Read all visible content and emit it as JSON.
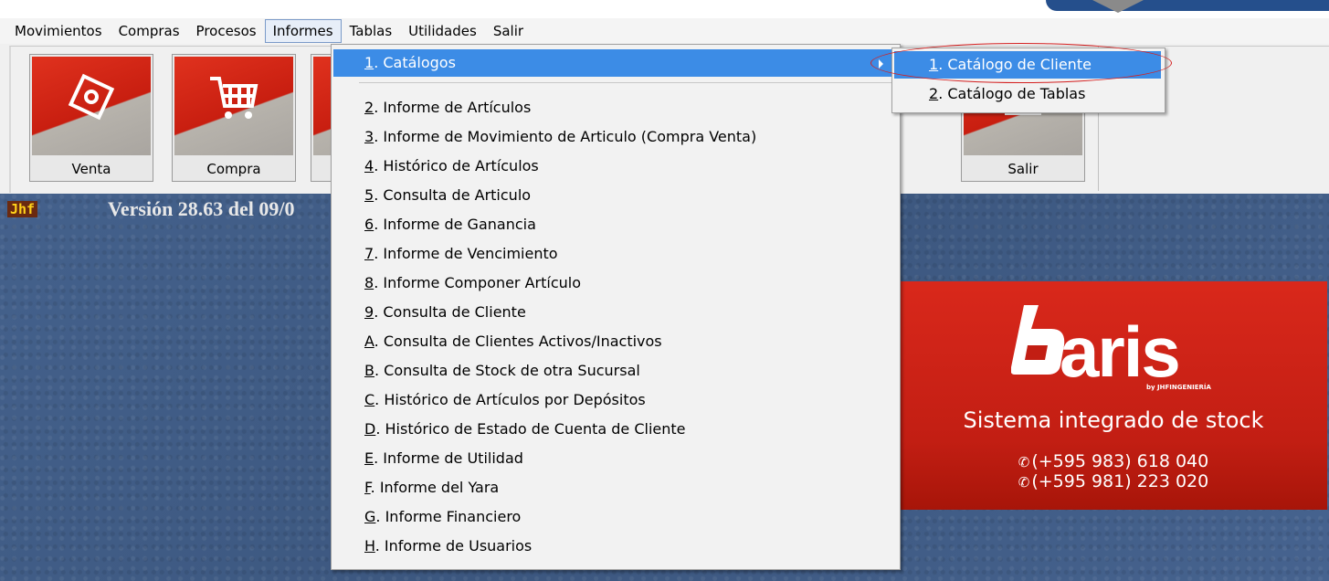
{
  "menubar": {
    "items": [
      "Movimientos",
      "Compras",
      "Procesos",
      "Informes",
      "Tablas",
      "Utilidades",
      "Salir"
    ],
    "open_index": 3
  },
  "toolbar": {
    "buttons": [
      {
        "label": "Venta",
        "icon": "tag-icon"
      },
      {
        "label": "Compra",
        "icon": "shopping-cart-icon"
      },
      {
        "label": "",
        "icon": "toolbar-icon"
      },
      {
        "label": "Salir",
        "icon": "exit-icon"
      }
    ]
  },
  "desktop": {
    "badge": "Jhf",
    "version": "Versión 28.63 del 09/0"
  },
  "banner": {
    "brand": "aris",
    "brand_sub": "by JHFINGENIERÍA",
    "tagline": "Sistema integrado de stock",
    "phone1": "(+595 983) 618 040",
    "phone2": "(+595 981) 223 020"
  },
  "informes_menu": {
    "items": [
      {
        "key": "1",
        "label": ". Catálogos"
      },
      {
        "key": "2",
        "label": ". Informe de Artículos"
      },
      {
        "key": "3",
        "label": ". Informe de Movimiento de Articulo (Compra Venta)"
      },
      {
        "key": "4",
        "label": ". Histórico de Artículos"
      },
      {
        "key": "5",
        "label": ". Consulta de Articulo"
      },
      {
        "key": "6",
        "label": ". Informe de Ganancia"
      },
      {
        "key": "7",
        "label": ". Informe de Vencimiento"
      },
      {
        "key": "8",
        "label": ". Informe Componer Artículo"
      },
      {
        "key": "9",
        "label": ". Consulta de Cliente"
      },
      {
        "key": "A",
        "label": ". Consulta de Clientes Activos/Inactivos"
      },
      {
        "key": "B",
        "label": ". Consulta de Stock de otra Sucursal"
      },
      {
        "key": "C",
        "label": ". Histórico de Artículos por Depósitos"
      },
      {
        "key": "D",
        "label": ". Histórico de Estado de Cuenta de Cliente"
      },
      {
        "key": "E",
        "label": ". Informe de Utilidad"
      },
      {
        "key": "F",
        "label": ". Informe del Yara"
      },
      {
        "key": "G",
        "label": ". Informe Financiero"
      },
      {
        "key": "H",
        "label": ". Informe de Usuarios"
      }
    ]
  },
  "catalogos_submenu": {
    "items": [
      {
        "key": "1",
        "label": ". Catálogo de Cliente"
      },
      {
        "key": "2",
        "label": ". Catálogo de Tablas"
      }
    ]
  },
  "colors": {
    "highlight": "#3c8ce6",
    "desktop": "#405c86",
    "banner": "#c21e13",
    "annotation": "#d42020"
  }
}
